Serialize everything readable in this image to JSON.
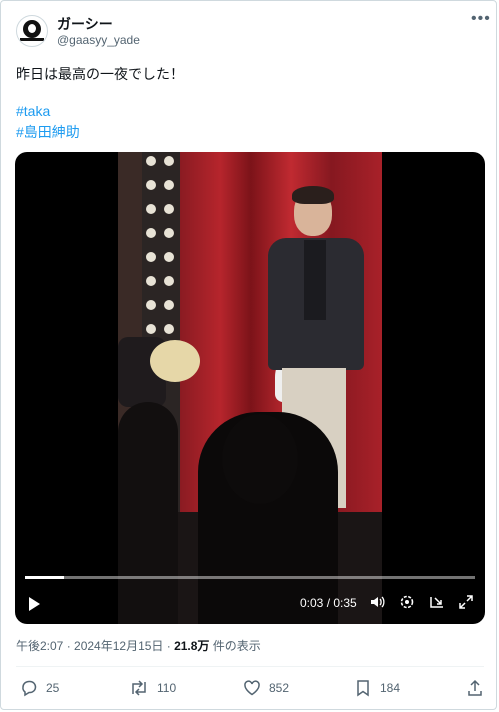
{
  "user": {
    "name": "ガーシー",
    "handle": "@gaasyy_yade"
  },
  "tweet": {
    "text": "昨日は最高の一夜でした！",
    "hashtags": [
      "#taka",
      "#島田紳助"
    ]
  },
  "video": {
    "current_time": "0:03",
    "duration": "0:35",
    "time_display": "0:03 / 0:35",
    "progress_fraction": 0.0857
  },
  "meta": {
    "timestamp": "午後2:07 · 2024年12月15日 · ",
    "views_count": "21.8万",
    "views_label": " 件の表示"
  },
  "actions": {
    "replies": "25",
    "retweets": "110",
    "likes": "852",
    "bookmarks": "184"
  },
  "colors": {
    "accent": "#1d9bf0",
    "secondary_text": "#536471",
    "border": "#cfd9de"
  },
  "icons": [
    "more-icon",
    "play-icon",
    "volume-icon",
    "settings-icon",
    "pip-icon",
    "fullscreen-icon",
    "reply-icon",
    "retweet-icon",
    "like-icon",
    "bookmark-icon",
    "share-icon"
  ]
}
